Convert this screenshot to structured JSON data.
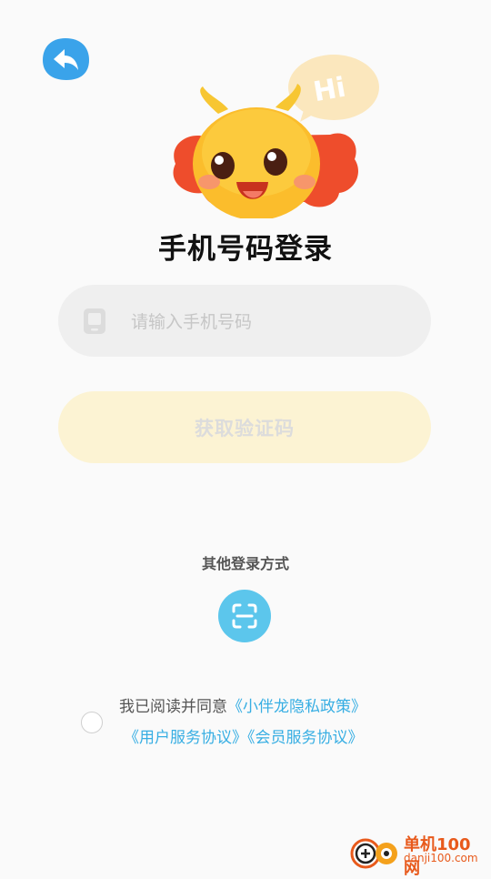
{
  "header": {
    "back_icon": "back-arrow-icon"
  },
  "mascot": {
    "bubble_text": "Hi"
  },
  "title": "手机号码登录",
  "phone": {
    "placeholder": "请输入手机号码",
    "icon": "phone-icon"
  },
  "get_code_label": "获取验证码",
  "other_login": {
    "label": "其他登录方式",
    "scan_icon": "scan-icon"
  },
  "agreement": {
    "prefix": "我已阅读并同意",
    "privacy_link": "《小伴龙隐私政策》",
    "user_link": "《用户服务协议》",
    "member_link": "《会员服务协议》"
  },
  "watermark": {
    "title": "单机100网",
    "url": "danji100.com"
  },
  "colors": {
    "accent_blue": "#37aee3",
    "button_yellow": "#fcf3d3",
    "scan_blue": "#5cc6ec"
  }
}
